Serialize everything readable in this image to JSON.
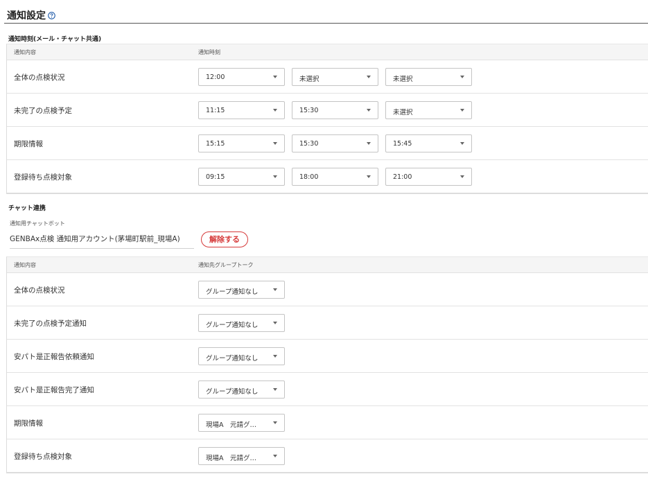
{
  "page": {
    "title": "通知設定",
    "help_icon": "question-circle-icon"
  },
  "notification_time": {
    "heading": "通知時刻(メール・チャット共通)",
    "col_content": "通知内容",
    "col_time": "通知時刻",
    "rows": [
      {
        "label": "全体の点検状況",
        "times": [
          "12:00",
          "未選択",
          "未選択"
        ]
      },
      {
        "label": "未完了の点検予定",
        "times": [
          "11:15",
          "15:30",
          "未選択"
        ]
      },
      {
        "label": "期限情報",
        "times": [
          "15:15",
          "15:30",
          "15:45"
        ]
      },
      {
        "label": "登録待ち点検対象",
        "times": [
          "09:15",
          "18:00",
          "21:00"
        ]
      }
    ]
  },
  "chat": {
    "heading": "チャット連携",
    "bot_label": "通知用チャットボット",
    "bot_name": "GENBAx点検 通知用アカウント(茅場町駅前_現場A)",
    "release_label": "解除する",
    "col_content": "通知内容",
    "col_group": "通知先グループトーク",
    "rows": [
      {
        "label": "全体の点検状況",
        "group": "グループ通知なし"
      },
      {
        "label": "未完了の点検予定通知",
        "group": "グループ通知なし"
      },
      {
        "label": "安パト是正報告依頼通知",
        "group": "グループ通知なし"
      },
      {
        "label": "安パト是正報告完了通知",
        "group": "グループ通知なし"
      },
      {
        "label": "期限情報",
        "group": "現場A　元請グ…"
      },
      {
        "label": "登録待ち点検対象",
        "group": "現場A　元請グ…"
      }
    ]
  },
  "colors": {
    "accent_red": "#d63a3a",
    "help_blue": "#1f5aa8"
  }
}
